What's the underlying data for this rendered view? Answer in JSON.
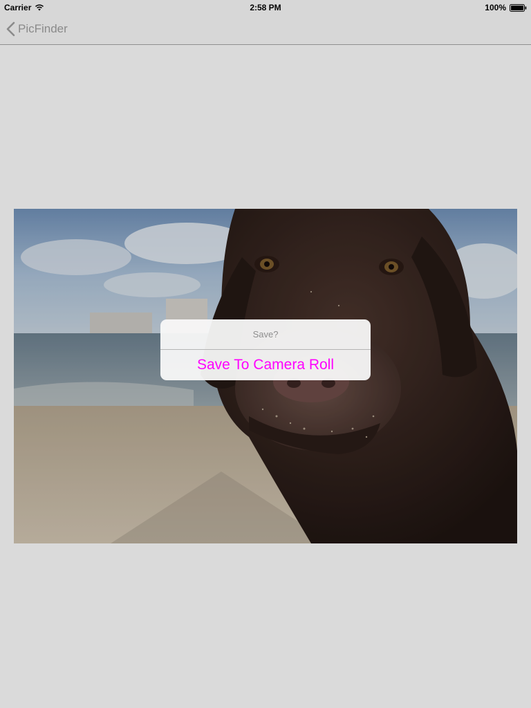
{
  "status_bar": {
    "carrier": "Carrier",
    "time": "2:58 PM",
    "battery": "100%"
  },
  "nav": {
    "back_label": "PicFinder"
  },
  "photo": {
    "alt": "dog photo"
  },
  "action_sheet": {
    "title": "Save?",
    "button_label": "Save To Camera Roll"
  },
  "colors": {
    "background": "#dadada",
    "accent": "#ff00ff",
    "nav_tint": "#8a8a8a"
  },
  "icons": {
    "back": "chevron-left-icon",
    "wifi": "wifi-icon",
    "battery": "battery-icon"
  }
}
